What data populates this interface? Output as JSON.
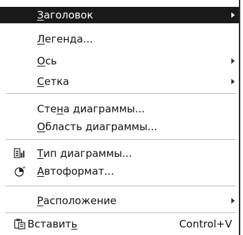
{
  "menu": {
    "items": [
      {
        "label": "Заголовок",
        "mnemonic_index": 0,
        "has_submenu": true,
        "selected": true
      },
      {
        "label": "Легенда...",
        "mnemonic_index": 0,
        "has_submenu": false
      },
      {
        "label": "Ось",
        "mnemonic_index": 0,
        "has_submenu": true
      },
      {
        "label": "Сетка",
        "mnemonic_index": 0,
        "has_submenu": true
      },
      {
        "label": "Стена диаграммы...",
        "mnemonic_index": 3,
        "has_submenu": false
      },
      {
        "label": "Область диаграммы...",
        "mnemonic_index": 0,
        "has_submenu": false
      },
      {
        "label": "Тип диаграммы...",
        "mnemonic_index": 0,
        "has_submenu": false,
        "icon": "chart-type-icon"
      },
      {
        "label": "Автоформат...",
        "mnemonic_index": 0,
        "has_submenu": false,
        "icon": "autoformat-icon"
      },
      {
        "label": "Расположение",
        "mnemonic_index": 0,
        "has_submenu": true
      },
      {
        "label": "Вставить",
        "mnemonic_index": 7,
        "has_submenu": false,
        "icon": "paste-icon",
        "shortcut": "Control+V"
      }
    ]
  },
  "colors": {
    "selected_background": "#1a1a1a",
    "selected_text": "#ffffff",
    "text": "#111111",
    "separator": "#bdbdbd"
  }
}
